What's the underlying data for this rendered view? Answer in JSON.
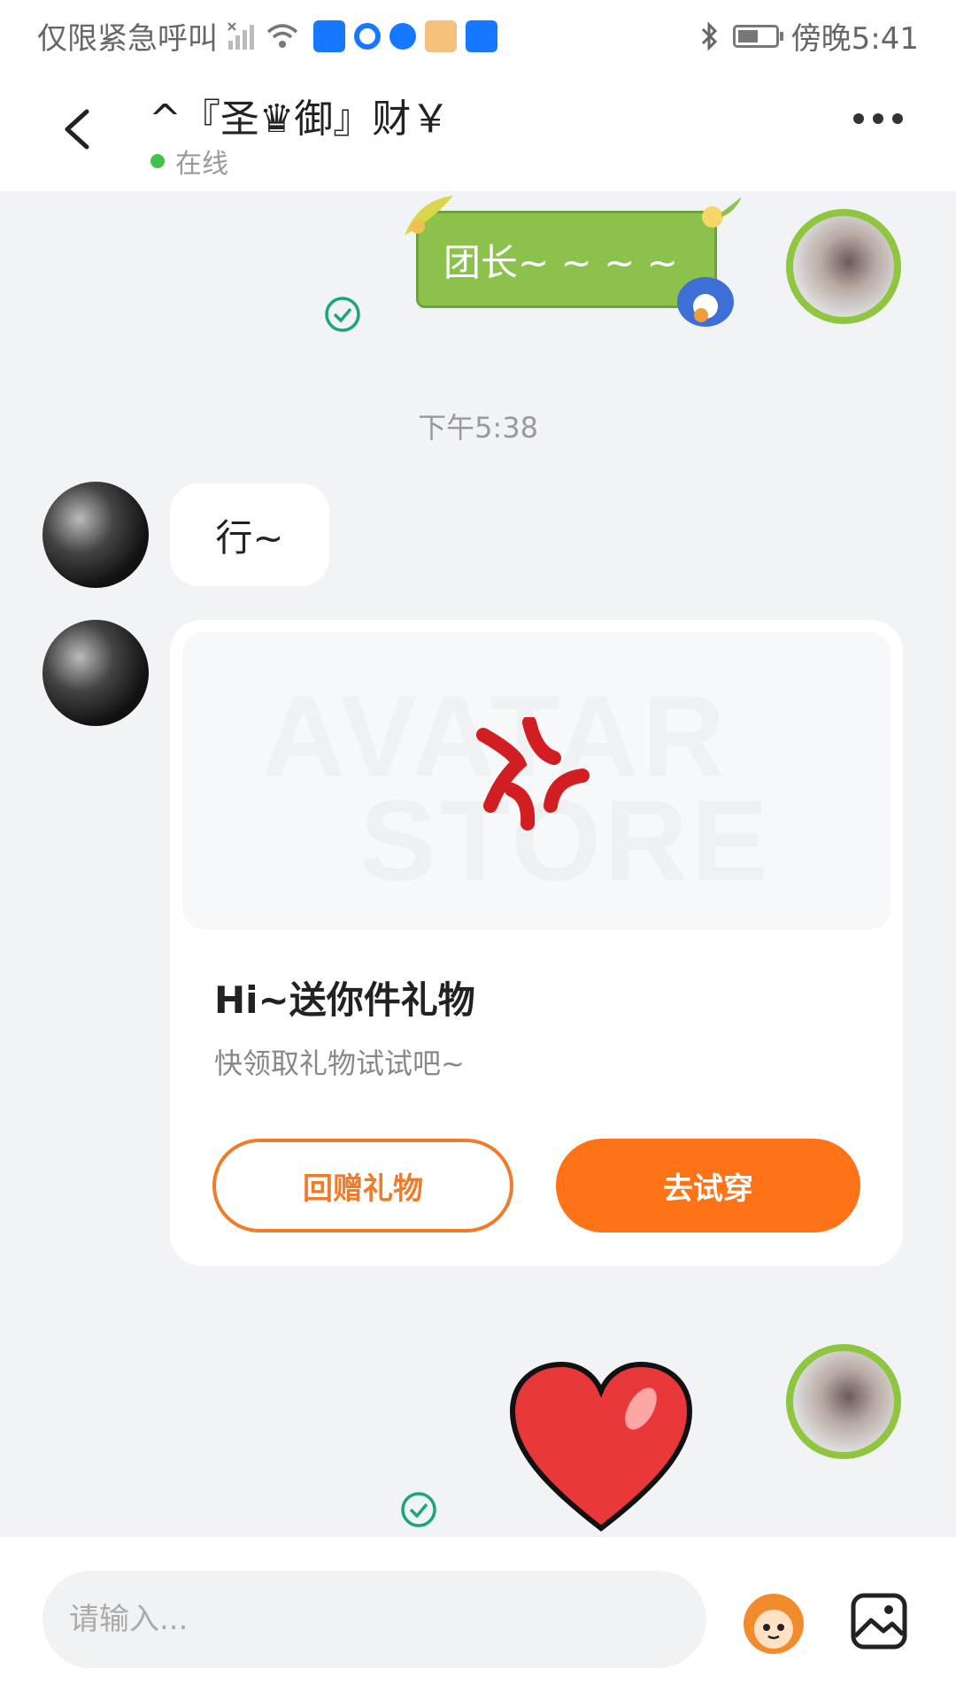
{
  "status_bar": {
    "carrier_text": "仅限紧急呼叫",
    "time": "傍晚5:41",
    "notification_icons": [
      "alipay-icon",
      "bank-icon",
      "browser-icon",
      "mascot-app-icon",
      "alipay-icon"
    ]
  },
  "header": {
    "title": "^『圣♛御』财￥",
    "status": "在线"
  },
  "messages": {
    "sent_1_text": "团长~ ~ ~ ~",
    "timestamp": "下午5:38",
    "received_1_text": "行~"
  },
  "gift_card": {
    "watermark_line1": "AVATAR",
    "watermark_line2": "STORE",
    "title": "Hi~送你件礼物",
    "subtitle": "快领取礼物试试吧~",
    "return_gift_label": "回赠礼物",
    "try_on_label": "去试穿"
  },
  "input": {
    "placeholder": "请输入..."
  },
  "colors": {
    "accent_orange": "#ff7318",
    "online_green": "#3ec24a",
    "bubble_green": "#8cc24b",
    "read_check": "#1aa57a"
  }
}
